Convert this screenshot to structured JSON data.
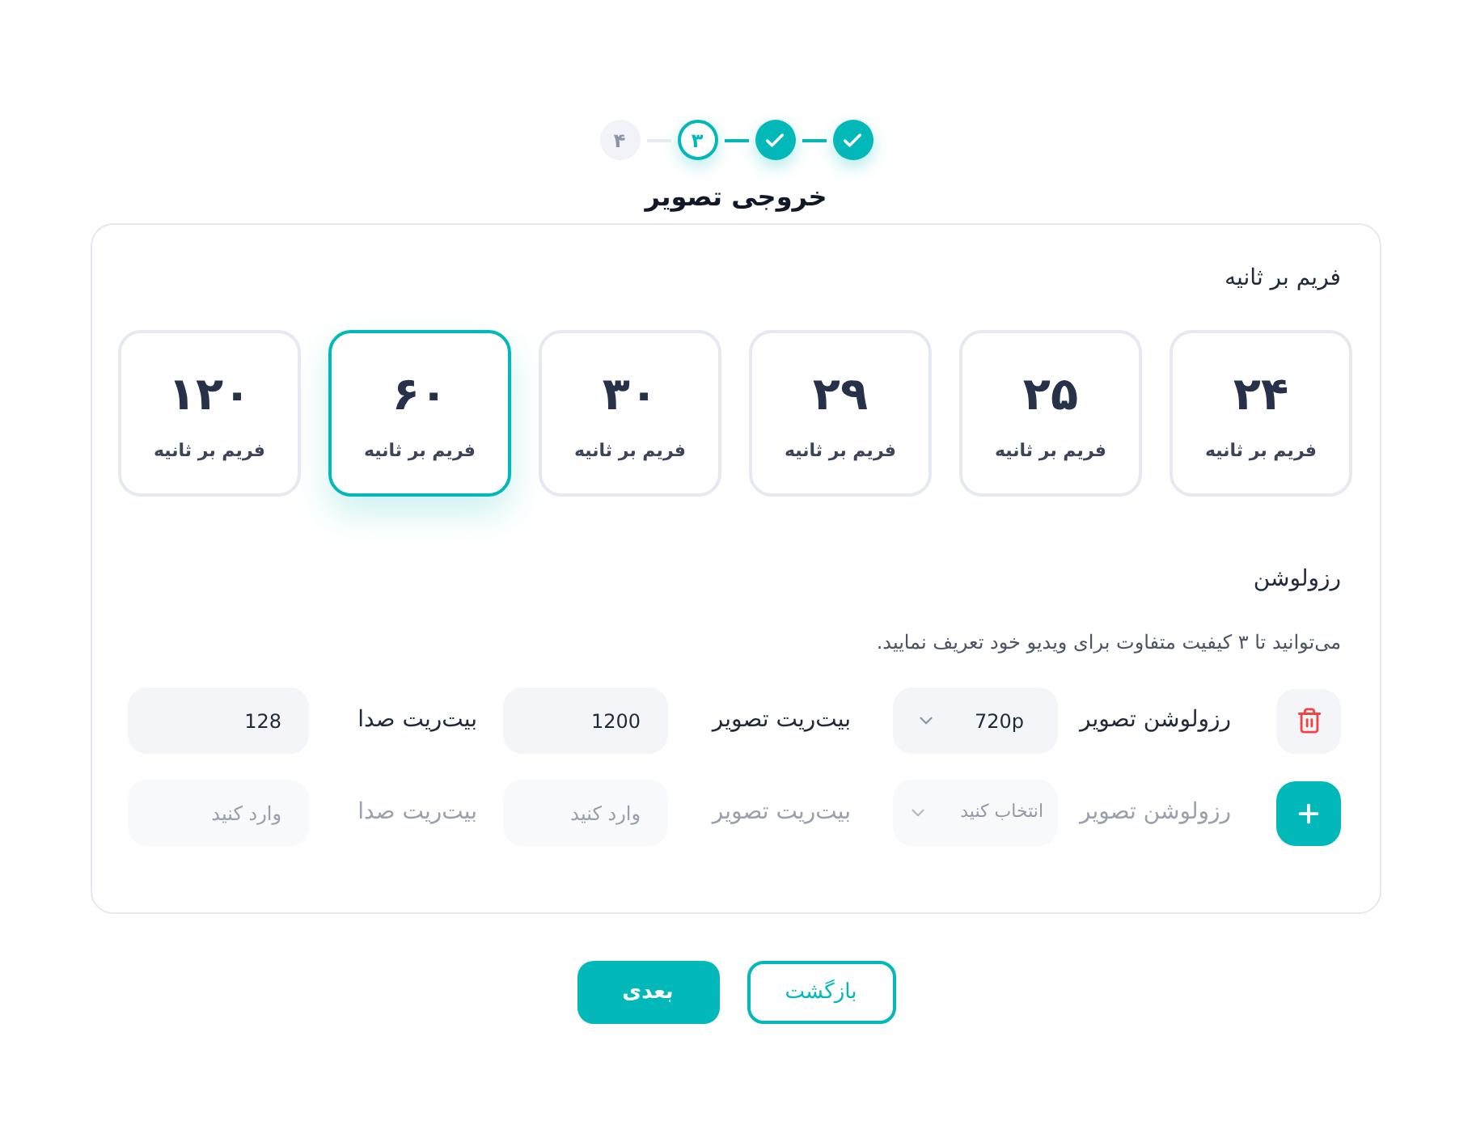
{
  "stepper": {
    "steps": [
      {
        "kind": "done"
      },
      {
        "kind": "done"
      },
      {
        "kind": "current",
        "number": "۳"
      },
      {
        "kind": "pending",
        "number": "۴"
      }
    ]
  },
  "title": "خروجی تصویر",
  "frame_rate": {
    "heading": "فریم بر ثانیه",
    "options": [
      {
        "value": "۲۴",
        "unit": "فریم بر ثانیه",
        "selected": false
      },
      {
        "value": "۲۵",
        "unit": "فریم بر ثانیه",
        "selected": false
      },
      {
        "value": "۲۹",
        "unit": "فریم بر ثانیه",
        "selected": false
      },
      {
        "value": "۳۰",
        "unit": "فریم بر ثانیه",
        "selected": false
      },
      {
        "value": "۶۰",
        "unit": "فریم بر ثانیه",
        "selected": true
      },
      {
        "value": "۱۲۰",
        "unit": "فریم بر ثانیه",
        "selected": false
      }
    ]
  },
  "resolution": {
    "heading": "رزولوشن",
    "description": "می‌توانید تا ۳ کیفیت متفاوت برای ویدیو خود تعریف نمایید.",
    "rows": [
      {
        "kind": "delete",
        "disabled": false,
        "resolution_label": "رزولوشن تصویر",
        "resolution": {
          "value": "720p"
        },
        "video_bitrate_label": "بیت‌ریت تصویر",
        "video_bitrate": {
          "value": "1200"
        },
        "audio_bitrate_label": "بیت‌ریت صدا",
        "audio_bitrate": {
          "value": "128"
        }
      },
      {
        "kind": "add",
        "disabled": true,
        "resolution_label": "رزولوشن تصویر",
        "resolution": {
          "placeholder": "انتخاب کنید"
        },
        "video_bitrate_label": "بیت‌ریت تصویر",
        "video_bitrate": {
          "placeholder": "وارد کنید"
        },
        "audio_bitrate_label": "بیت‌ریت صدا",
        "audio_bitrate": {
          "placeholder": "وارد کنید"
        }
      }
    ]
  },
  "buttons": [
    {
      "label": "بازگشت",
      "kind": "outline"
    },
    {
      "label": "بعدی",
      "kind": "primary"
    }
  ]
}
